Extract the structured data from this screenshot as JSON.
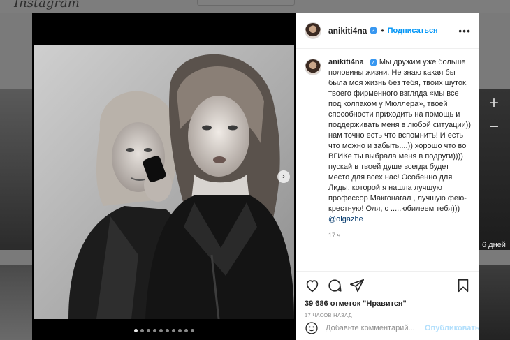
{
  "background": {
    "logo": "Instagram",
    "days_label": "6 дней",
    "plus": "+",
    "minus": "−"
  },
  "post": {
    "username": "anikiti4na",
    "verified_icon": "verified-badge-icon",
    "follow_label": "Подписаться",
    "more_label": "•••",
    "caption": "Мы дружим уже больше половины жизни. Не знаю какая бы была моя жизнь без тебя, твоих шуток, твоего фирменного взгляда «мы все под колпаком у Мюллера», твоей способности приходить на помощь и поддерживать меня в любой ситуации)) нам точно есть что вспомнить! И есть что можно и забыть....)) хорошо что во ВГИКе ты выбрала меня в подруги)))) пускай в твоей душе всегда будет место для всех нас! Особенно для Лиды, которой я нашла лучшую профессор Макгонагал , лучшую фею-крестную! Оля, с .....юбилеем тебя)))",
    "mention": "@olgazhe",
    "caption_time": "17 ч.",
    "likes": "39 686 отметок \"Нравится\"",
    "posted_ago": "17 ЧАСОВ НАЗАД",
    "comment_placeholder": "Добавьте комментарий...",
    "publish_label": "Опубликовать",
    "carousel": {
      "total": 10,
      "active_index": 0
    },
    "icons": {
      "like": "heart-icon",
      "comment": "comment-bubble-icon",
      "share": "paper-plane-icon",
      "save": "bookmark-icon",
      "emoji": "smiley-icon",
      "next": "chevron-right-icon"
    }
  }
}
